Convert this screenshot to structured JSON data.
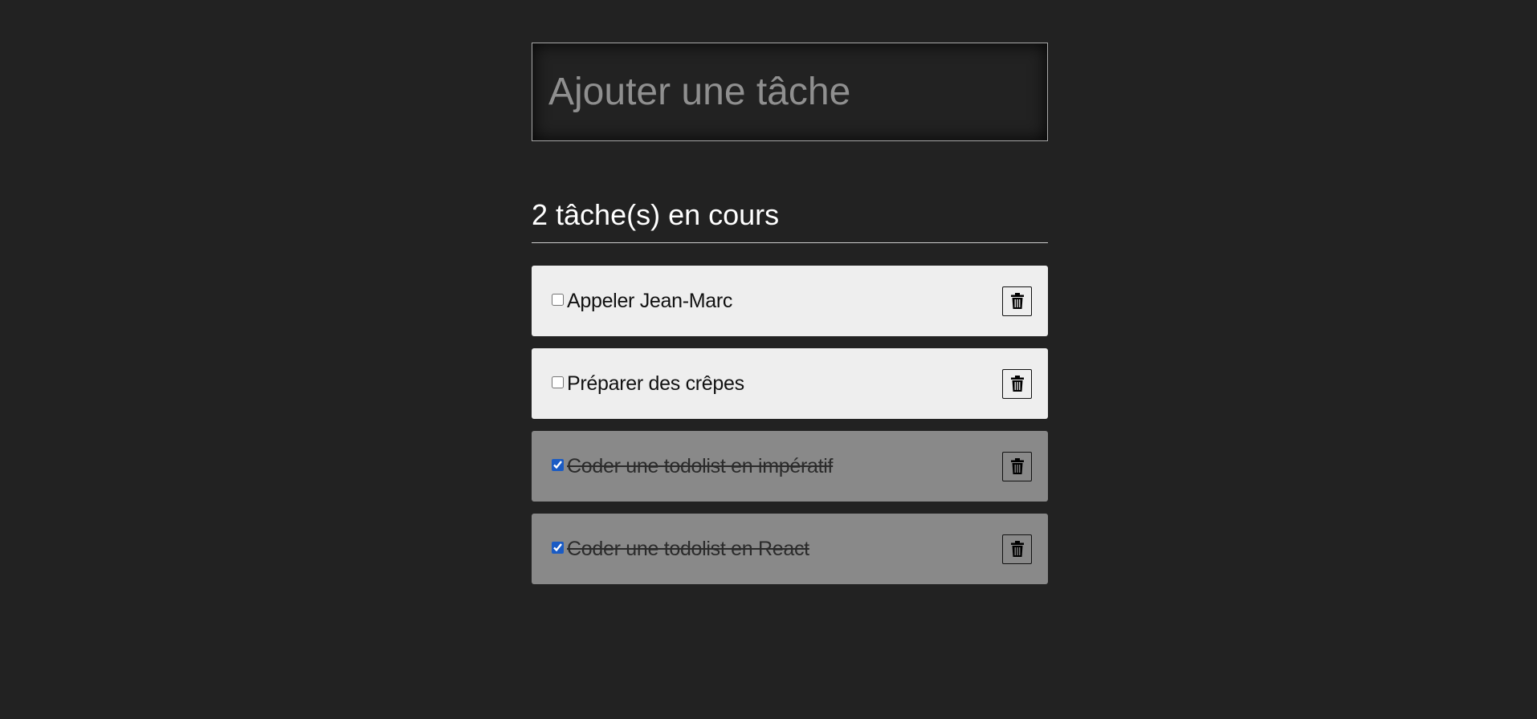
{
  "add_task": {
    "placeholder": "Ajouter une tâche",
    "value": ""
  },
  "summary": {
    "count_label": "2 tâche(s) en cours"
  },
  "tasks": [
    {
      "label": "Appeler Jean-Marc",
      "done": false
    },
    {
      "label": "Préparer des crêpes",
      "done": false
    },
    {
      "label": "Coder une todolist en impératif",
      "done": true
    },
    {
      "label": "Coder une todolist en React",
      "done": true
    }
  ],
  "icons": {
    "delete": "trash-icon"
  },
  "colors": {
    "background": "#222222",
    "task_pending": "#eeeeee",
    "task_done": "#898989",
    "checkbox_accent": "#1a5bc4"
  }
}
